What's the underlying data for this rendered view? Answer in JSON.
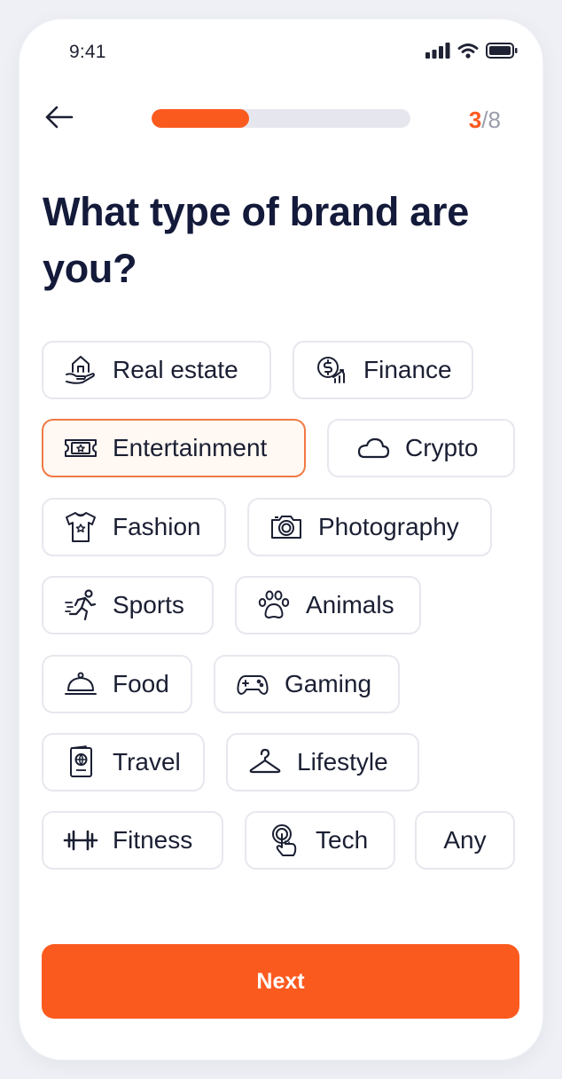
{
  "status_bar": {
    "time": "9:41"
  },
  "progress": {
    "current": "3",
    "separator": "/",
    "total": "8",
    "fraction": 0.375
  },
  "question": {
    "title": "What type of brand are you?"
  },
  "chips": [
    {
      "label": "Real estate",
      "icon": "house-hand-icon",
      "selected": false
    },
    {
      "label": "Finance",
      "icon": "money-chart-icon",
      "selected": false
    },
    {
      "label": "Entertainment",
      "icon": "ticket-icon",
      "selected": true
    },
    {
      "label": "Crypto",
      "icon": "cloud-icon",
      "selected": false
    },
    {
      "label": "Fashion",
      "icon": "tshirt-icon",
      "selected": false
    },
    {
      "label": "Photography",
      "icon": "camera-icon",
      "selected": false
    },
    {
      "label": "Sports",
      "icon": "runner-icon",
      "selected": false
    },
    {
      "label": "Animals",
      "icon": "paw-icon",
      "selected": false
    },
    {
      "label": "Food",
      "icon": "food-cloche-icon",
      "selected": false
    },
    {
      "label": "Gaming",
      "icon": "gamepad-icon",
      "selected": false
    },
    {
      "label": "Travel",
      "icon": "passport-icon",
      "selected": false
    },
    {
      "label": "Lifestyle",
      "icon": "hanger-icon",
      "selected": false
    },
    {
      "label": "Fitness",
      "icon": "dumbbell-icon",
      "selected": false
    },
    {
      "label": "Tech",
      "icon": "touch-icon",
      "selected": false
    },
    {
      "label": "Any",
      "icon": "",
      "selected": false
    }
  ],
  "next_button": {
    "label": "Next"
  },
  "colors": {
    "accent": "#fb5a1f",
    "selected_border": "#f07a44",
    "selected_bg": "#fff8f3",
    "title": "#141a3a"
  }
}
